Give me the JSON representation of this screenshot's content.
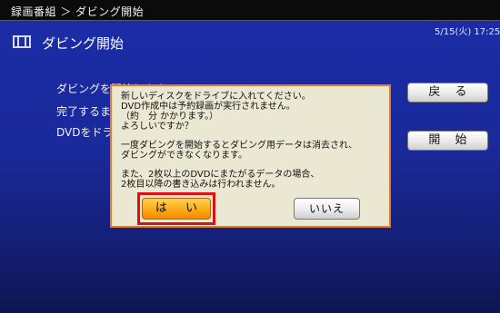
{
  "header": {
    "breadcrumb": "録画番組 ＞ ダビング開始"
  },
  "status": {
    "datetime": "5/15(火) 17:25"
  },
  "page": {
    "title": "ダビング開始",
    "icon": "film-icon"
  },
  "background_lines": [
    "ダビングを開始します",
    "完了するまで",
    "DVDをドライ"
  ],
  "side_buttons": {
    "back_label": "戻 る",
    "start_label": "開 始"
  },
  "dialog": {
    "lines": [
      "新しいディスクをドライブに入れてください。",
      "DVD作成中は予約録画が実行されません。",
      "（約　分 かかります。）",
      "よろしいですか？",
      "一度ダビングを開始するとダビング用データは消去され、",
      "ダビングができなくなります。",
      "また、2枚以上のDVDにまたがるデータの場合、",
      "2枚目以降の書き込みは行われません。"
    ],
    "yes_label": "は い",
    "no_label": "いいえ"
  },
  "colors": {
    "dialog_border": "#ee7a1b",
    "yes_button": "#ffae1a",
    "highlight": "#e01010",
    "background": "#1b2ca8"
  }
}
